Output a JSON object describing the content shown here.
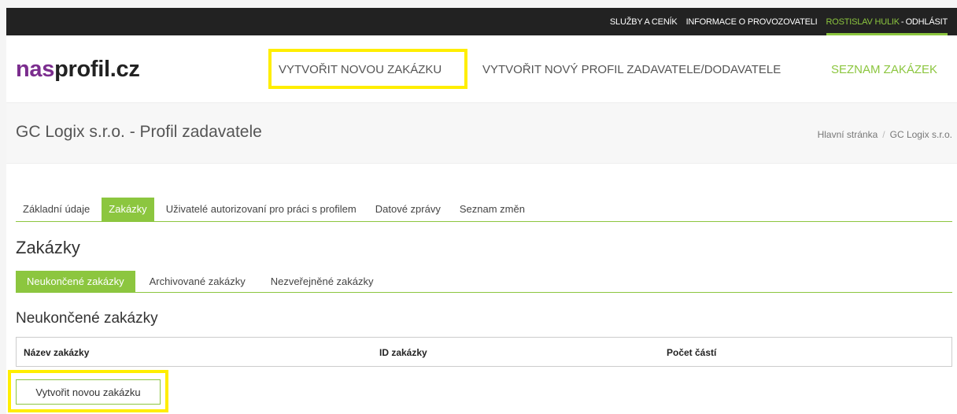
{
  "topbar": {
    "services": "SLUŽBY A CENÍK",
    "operator_info": "INFORMACE O PROVOZOVATELI",
    "user": "ROSTISLAV HULIK",
    "separator": "-",
    "logout": "ODHLÁSIT"
  },
  "logo": {
    "part1": "nas",
    "part2": "profil.cz"
  },
  "mainnav": {
    "create_order": "VYTVOŘIT NOVOU ZAKÁZKU",
    "create_profile": "VYTVOŘIT NOVÝ PROFIL ZADAVATELE/DODAVATELE",
    "order_list": "SEZNAM ZAKÁZEK"
  },
  "page": {
    "title": "GC Logix s.r.o. - Profil zadavatele",
    "breadcrumb": [
      "Hlavní stránka",
      "GC Logix s.r.o."
    ]
  },
  "tabs": [
    {
      "label": "Základní údaje",
      "active": false
    },
    {
      "label": "Zakázky",
      "active": true
    },
    {
      "label": "Uživatelé autorizovaní pro práci s profilem",
      "active": false
    },
    {
      "label": "Datové zprávy",
      "active": false
    },
    {
      "label": "Seznam změn",
      "active": false
    }
  ],
  "section": {
    "title": "Zakázky",
    "subtabs": [
      {
        "label": "Neukončené zakázky",
        "active": true
      },
      {
        "label": "Archivované zakázky",
        "active": false
      },
      {
        "label": "Nezveřejněné zakázky",
        "active": false
      }
    ],
    "subtitle": "Neukončené zakázky",
    "table_headers": [
      "Název zakázky",
      "ID zakázky",
      "Počet částí"
    ],
    "new_button": "Vytvořit novou zakázku"
  },
  "colors": {
    "accent": "#8cc63f",
    "logo_purple": "#7b2d8e",
    "highlight": "#ffee00",
    "topbar": "#222222"
  }
}
